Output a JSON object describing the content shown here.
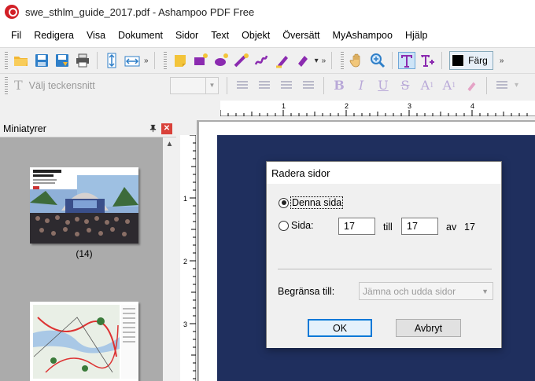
{
  "window": {
    "title": "swe_sthlm_guide_2017.pdf - Ashampoo PDF Free"
  },
  "menu": [
    "Fil",
    "Redigera",
    "Visa",
    "Dokument",
    "Sidor",
    "Text",
    "Objekt",
    "Översätt",
    "MyAshampoo",
    "Hjälp"
  ],
  "toolbar": {
    "color_label": "Färg",
    "overflow": "»"
  },
  "format_bar": {
    "font_placeholder": "Välj teckensnitt"
  },
  "ruler": {
    "h_numbers": [
      "1",
      "2",
      "3",
      "4"
    ],
    "v_numbers": [
      "1",
      "2",
      "3"
    ]
  },
  "sidebar": {
    "title": "Miniatyrer",
    "pin_glyph": "📌",
    "close_glyph": "✕",
    "thumbnails": [
      {
        "label": "(14)"
      },
      {
        "label": ""
      }
    ]
  },
  "dialog": {
    "title": "Radera sidor",
    "option_current": "Denna sida",
    "option_pages": "Sida:",
    "from_value": "17",
    "to_label": "till",
    "to_value": "17",
    "of_label": "av",
    "total_pages": "17",
    "limit_label": "Begränsa till:",
    "limit_value": "Jämna och udda sidor",
    "ok_label": "OK",
    "cancel_label": "Avbryt"
  },
  "colors": {
    "accent": "#0078d7",
    "page_bg": "#1f2f5e",
    "logo": "#d21f26"
  }
}
